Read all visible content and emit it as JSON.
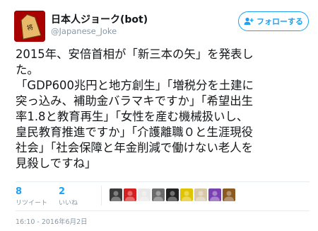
{
  "account": {
    "display_name": "日本人ジョーク(bot)",
    "handle": "@Japanese_Joke",
    "avatar_icon": "shogi-piece-icon"
  },
  "follow_button": {
    "label": "フォローする",
    "icon": "add-user-icon",
    "color": "#1da1f2"
  },
  "tweet": {
    "lines": [
      "2015年、安倍首相が「新三本の矢」を発表し",
      "た。",
      "「GDP600兆円と地方創生」「増税分を土建に",
      "突っ込み、補助金バラマキですか」「希望出生",
      "率1.8と教育再生」「女性を産む機械扱いし、",
      "皇民教育推進ですか」「介護離職０と生涯現役",
      "社会」「社会保障と年金削減で働けない老人を",
      "見殺しですね」"
    ]
  },
  "stats": {
    "retweets": {
      "count": "8",
      "label": "リツイート"
    },
    "likes": {
      "count": "2",
      "label": "いいね"
    }
  },
  "likers": [
    {
      "icon": "avatar-dark-icon",
      "color": "#3a3a3a"
    },
    {
      "icon": "avatar-red-icon",
      "color": "#d42020"
    },
    {
      "icon": "avatar-white-icon",
      "color": "#e8e8e8"
    },
    {
      "icon": "avatar-gray-icon",
      "color": "#6b6b6b"
    },
    {
      "icon": "avatar-black-icon",
      "color": "#222222"
    },
    {
      "icon": "avatar-yellow-icon",
      "color": "#e0c400"
    },
    {
      "icon": "avatar-beige-icon",
      "color": "#d8c8a8"
    },
    {
      "icon": "avatar-purple-icon",
      "color": "#7a3fb0"
    },
    {
      "icon": "avatar-brown-icon",
      "color": "#8a5a20"
    }
  ],
  "timestamp": "16:10 - 2016年6月2日"
}
